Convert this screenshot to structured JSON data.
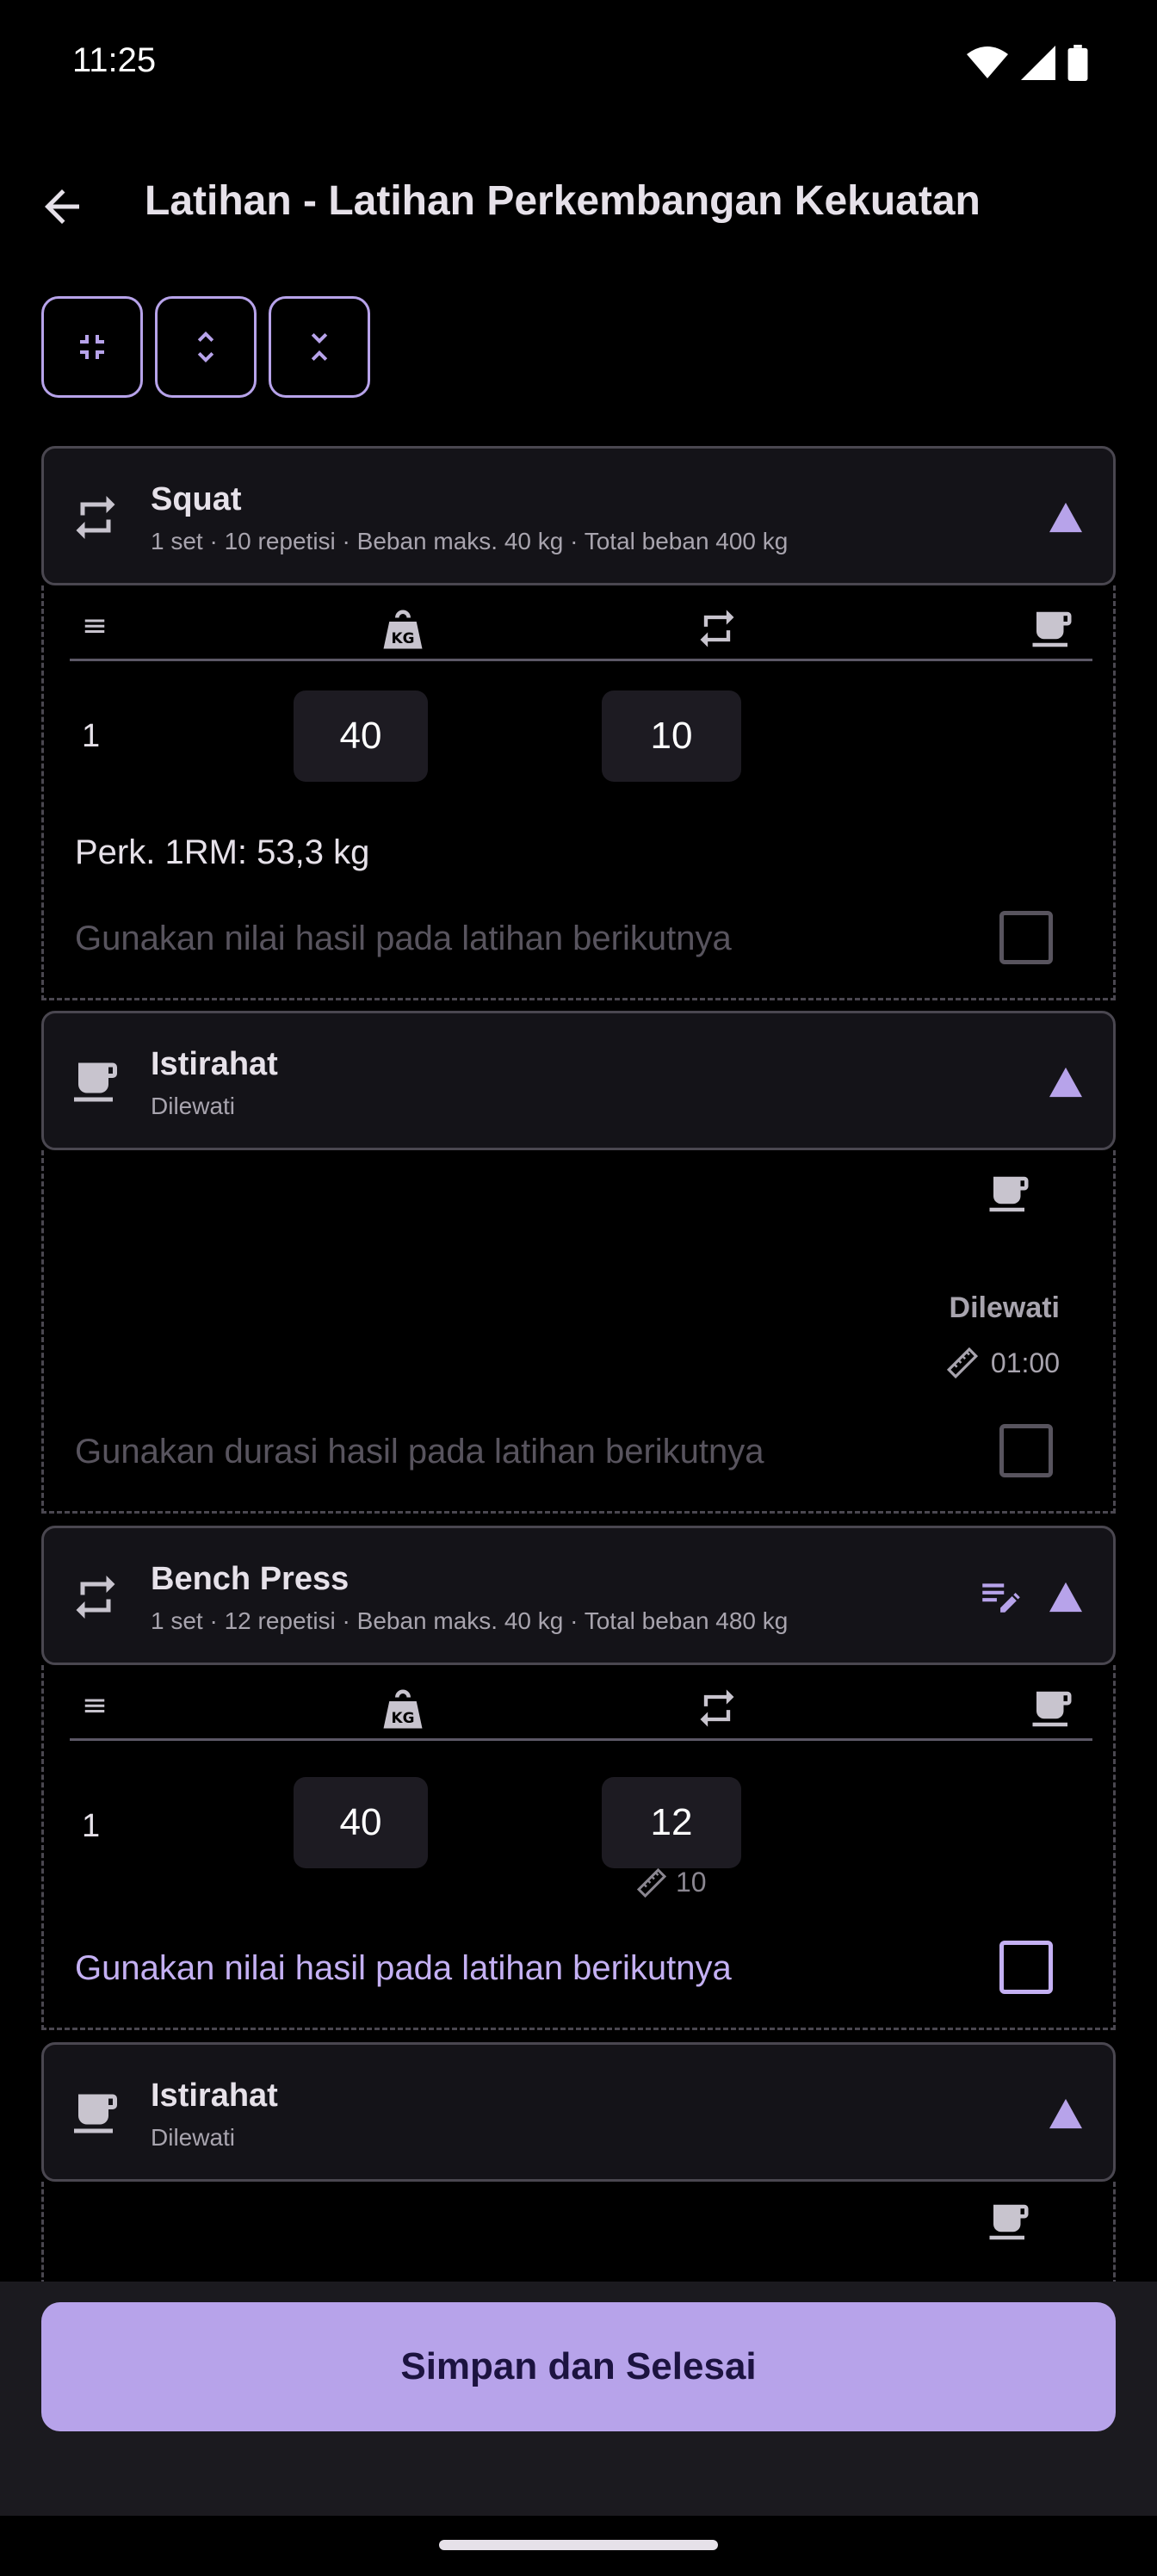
{
  "status_bar": {
    "time": "11:25"
  },
  "app_bar": {
    "title": "Latihan - Latihan Perkembangan Kekuatan"
  },
  "colors": {
    "accent": "#b7a3ea",
    "surface": "#141318",
    "background": "#000000"
  },
  "exercises": [
    {
      "type": "exercise",
      "name": "Squat",
      "summary": "1 set · 10 repetisi · Beban maks. 40 kg · Total beban 400 kg",
      "sets": [
        {
          "number": "1",
          "weight": "40",
          "reps": "10"
        }
      ],
      "estimate": "Perk. 1RM: 53,3 kg",
      "option_label": "Gunakan nilai hasil pada latihan berikutnya"
    },
    {
      "type": "rest",
      "name": "Istirahat",
      "summary": "Dilewati",
      "status_label": "Dilewati",
      "duration": "01:00",
      "option_label": "Gunakan durasi hasil pada latihan berikutnya"
    },
    {
      "type": "exercise",
      "name": "Bench Press",
      "summary": "1 set · 12 repetisi · Beban maks. 40 kg · Total beban 480 kg",
      "sets": [
        {
          "number": "1",
          "weight": "40",
          "reps": "12",
          "previous_reps": "10"
        }
      ],
      "option_label": "Gunakan nilai hasil pada latihan berikutnya"
    },
    {
      "type": "rest",
      "name": "Istirahat",
      "summary": "Dilewati"
    }
  ],
  "footer": {
    "save_label": "Simpan dan Selesai"
  }
}
